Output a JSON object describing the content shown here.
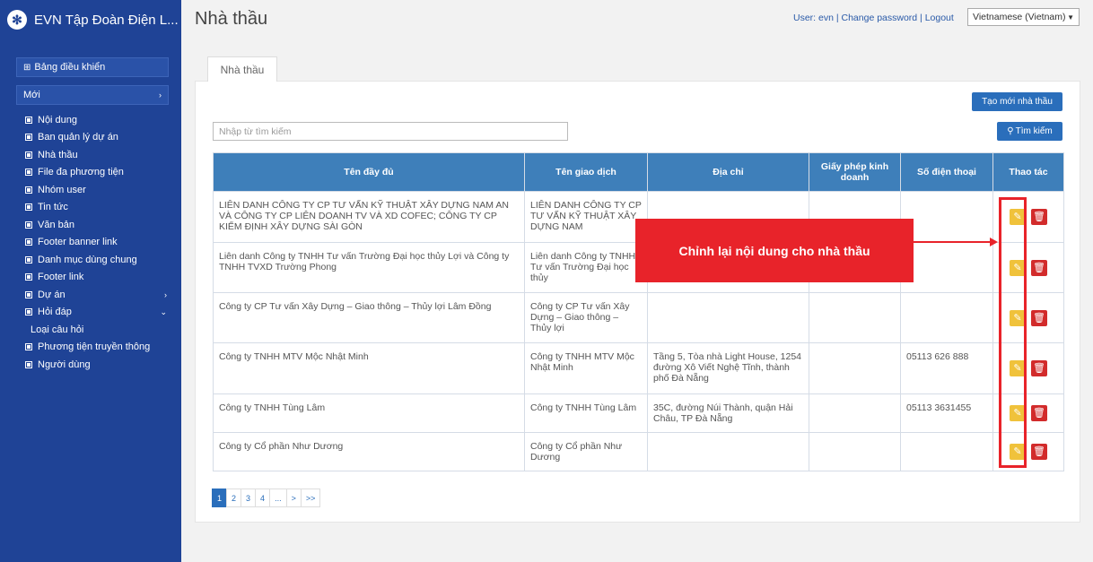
{
  "app": {
    "title": "EVN Tập Đoàn Điện L...",
    "logo_icon": "fan-logo-icon"
  },
  "sidebar": {
    "dashboard_label": "Bảng điều khiển",
    "new_label": "Mới",
    "items": [
      {
        "label": "Nội dung",
        "icon": "document-icon"
      },
      {
        "label": "Ban quản lý dự án",
        "icon": "square-icon"
      },
      {
        "label": "Nhà thầu",
        "icon": "square-icon"
      },
      {
        "label": "File đa phương tiện",
        "icon": "square-icon"
      },
      {
        "label": "Nhóm user",
        "icon": "square-icon"
      },
      {
        "label": "Tin tức",
        "icon": "square-icon"
      },
      {
        "label": "Văn bản",
        "icon": "square-icon"
      },
      {
        "label": "Footer banner link",
        "icon": "square-icon"
      },
      {
        "label": "Danh mục dùng chung",
        "icon": "square-icon"
      },
      {
        "label": "Footer link",
        "icon": "square-icon"
      },
      {
        "label": "Dự án",
        "icon": "square-icon",
        "arrow": "›"
      },
      {
        "label": "Hỏi đáp",
        "icon": "square-icon",
        "arrow": "⌄"
      },
      {
        "label": "Loại câu hỏi",
        "icon": ""
      },
      {
        "label": "Phương tiện truyền thông",
        "icon": "image-icon"
      },
      {
        "label": "Người dùng",
        "icon": "user-icon"
      }
    ]
  },
  "header": {
    "page_title": "Nhà thầu",
    "user_label": "User: evn",
    "change_password": "Change password",
    "logout": "Logout",
    "language": "Vietnamese (Vietnam)"
  },
  "content": {
    "tab_label": "Nhà thầu",
    "create_button": "Tạo mới nhà thầu",
    "search_placeholder": "Nhập từ tìm kiếm",
    "search_button": "Tìm kiếm",
    "table": {
      "headers": [
        "Tên đầy đủ",
        "Tên giao dịch",
        "Địa chỉ",
        "Giấy phép kinh doanh",
        "Số điện thoại",
        "Thao tác"
      ],
      "rows": [
        {
          "full_name": "LIÊN DANH CÔNG TY CP TƯ VẤN KỸ THUẬT XÂY DỰNG NAM AN VÀ CÔNG TY CP LIÊN DOANH TV VÀ XD COFEC; CÔNG TY CP KIỂM ĐỊNH XÂY DỰNG SÀI GÒN",
          "trade_name": "LIÊN DANH CÔNG TY CP TƯ VẤN KỸ THUẬT XÂY DỰNG NAM",
          "address": "",
          "license": "",
          "phone": ""
        },
        {
          "full_name": "Liên danh Công ty TNHH Tư vấn Trường Đại học thủy Lợi và Công ty TNHH TVXD Trường Phong",
          "trade_name": "Liên danh Công ty TNHH Tư vấn Trường Đại học thủy",
          "address": "",
          "license": "",
          "phone": ""
        },
        {
          "full_name": "Công ty CP Tư vấn Xây Dựng – Giao thông – Thủy lợi Lâm Đồng",
          "trade_name": "Công ty CP Tư vấn Xây Dựng – Giao thông – Thủy lợi",
          "address": "",
          "license": "",
          "phone": ""
        },
        {
          "full_name": "Công ty TNHH MTV Mộc Nhật Minh",
          "trade_name": "Công ty TNHH MTV Mộc Nhật Minh",
          "address": "Tầng 5, Tòa nhà Light House, 1254 đường Xô Viết Nghệ Tĩnh, thành phố Đà Nẵng",
          "license": "",
          "phone": "05113 626 888"
        },
        {
          "full_name": "Công ty TNHH Tùng Lâm",
          "trade_name": "Công ty TNHH Tùng Lâm",
          "address": "35C, đường Núi Thành, quận Hải Châu, TP Đà Nẵng",
          "license": "",
          "phone": "05113 3631455"
        },
        {
          "full_name": "Công ty Cổ phần Như Dương",
          "trade_name": "Công ty Cổ phần Như Dương",
          "address": "",
          "license": "",
          "phone": ""
        }
      ]
    },
    "annotation": "Chỉnh lại nội dung cho nhà thầu",
    "pagination": [
      "1",
      "2",
      "3",
      "4",
      "...",
      ">",
      ">>"
    ],
    "active_page": "1"
  },
  "colors": {
    "sidebar_bg": "#1f4396",
    "table_header_bg": "#3e7fba",
    "primary_button": "#2a6ebb",
    "edit_icon_bg": "#f0c23b",
    "delete_icon_bg": "#d22b2b",
    "annotation_red": "#e8232a"
  }
}
